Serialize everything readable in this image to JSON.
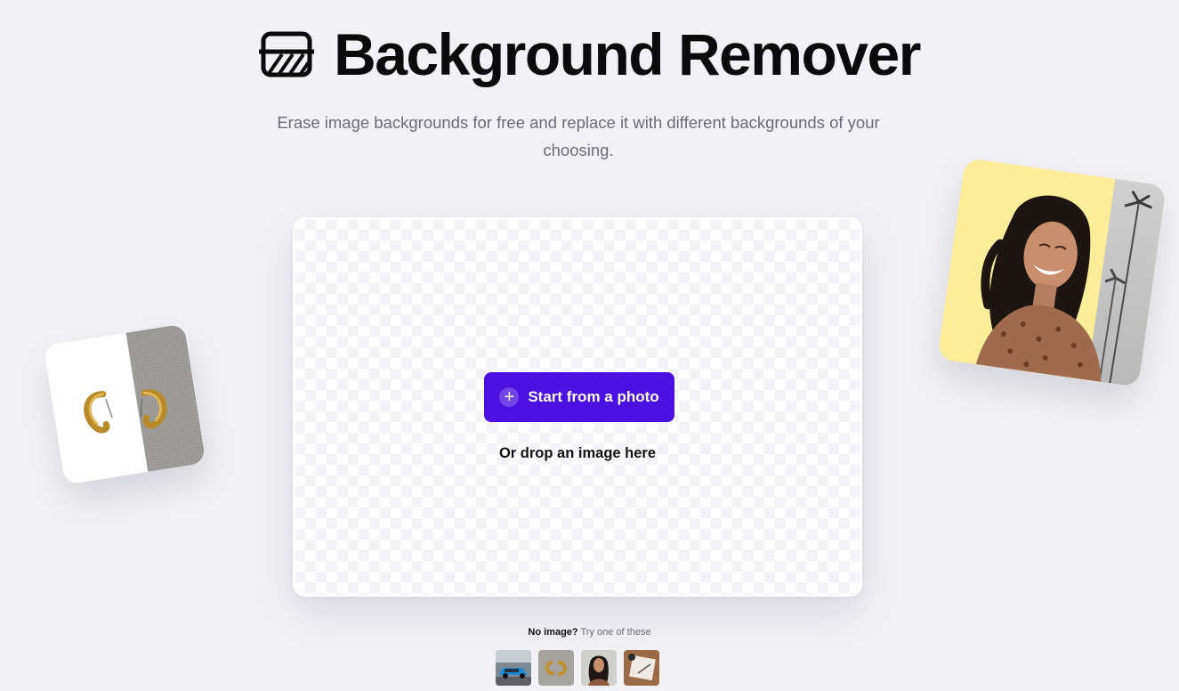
{
  "header": {
    "logo_icon": "background-remover-icon",
    "title": "Background Remover",
    "subtitle": "Erase image backgrounds for free and replace it with different backgrounds of your choosing."
  },
  "upload": {
    "button_label": "Start from a photo",
    "button_icon": "plus-icon",
    "drop_text": "Or drop an image here"
  },
  "samples": {
    "label_strong": "No image?",
    "label_muted": "Try one of these",
    "items": [
      {
        "name": "sample-car"
      },
      {
        "name": "sample-earrings"
      },
      {
        "name": "sample-woman"
      },
      {
        "name": "sample-desk"
      }
    ]
  },
  "colors": {
    "accent": "#4a11e0",
    "background": "#f2f2f6",
    "muted_text": "#6b6b78",
    "deco_yellow": "#fbed9a"
  }
}
